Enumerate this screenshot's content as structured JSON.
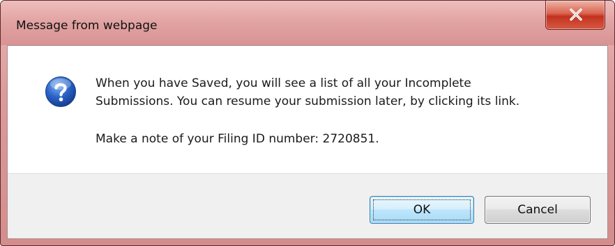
{
  "dialog": {
    "title": "Message from webpage",
    "icon": "question-icon",
    "message_lines": [
      "When you have Saved, you will see a list of all your Incomplete",
      "Submissions. You can resume your submission later, by clicking its link."
    ],
    "note_line": "Make a note of your Filing ID number: 2720851.",
    "buttons": {
      "ok_label": "OK",
      "cancel_label": "Cancel"
    }
  },
  "colors": {
    "titlebar": "#e3a4a4",
    "close_button": "#c2321e",
    "ok_button": "#bee6fd",
    "button_area": "#f0f0f0"
  }
}
